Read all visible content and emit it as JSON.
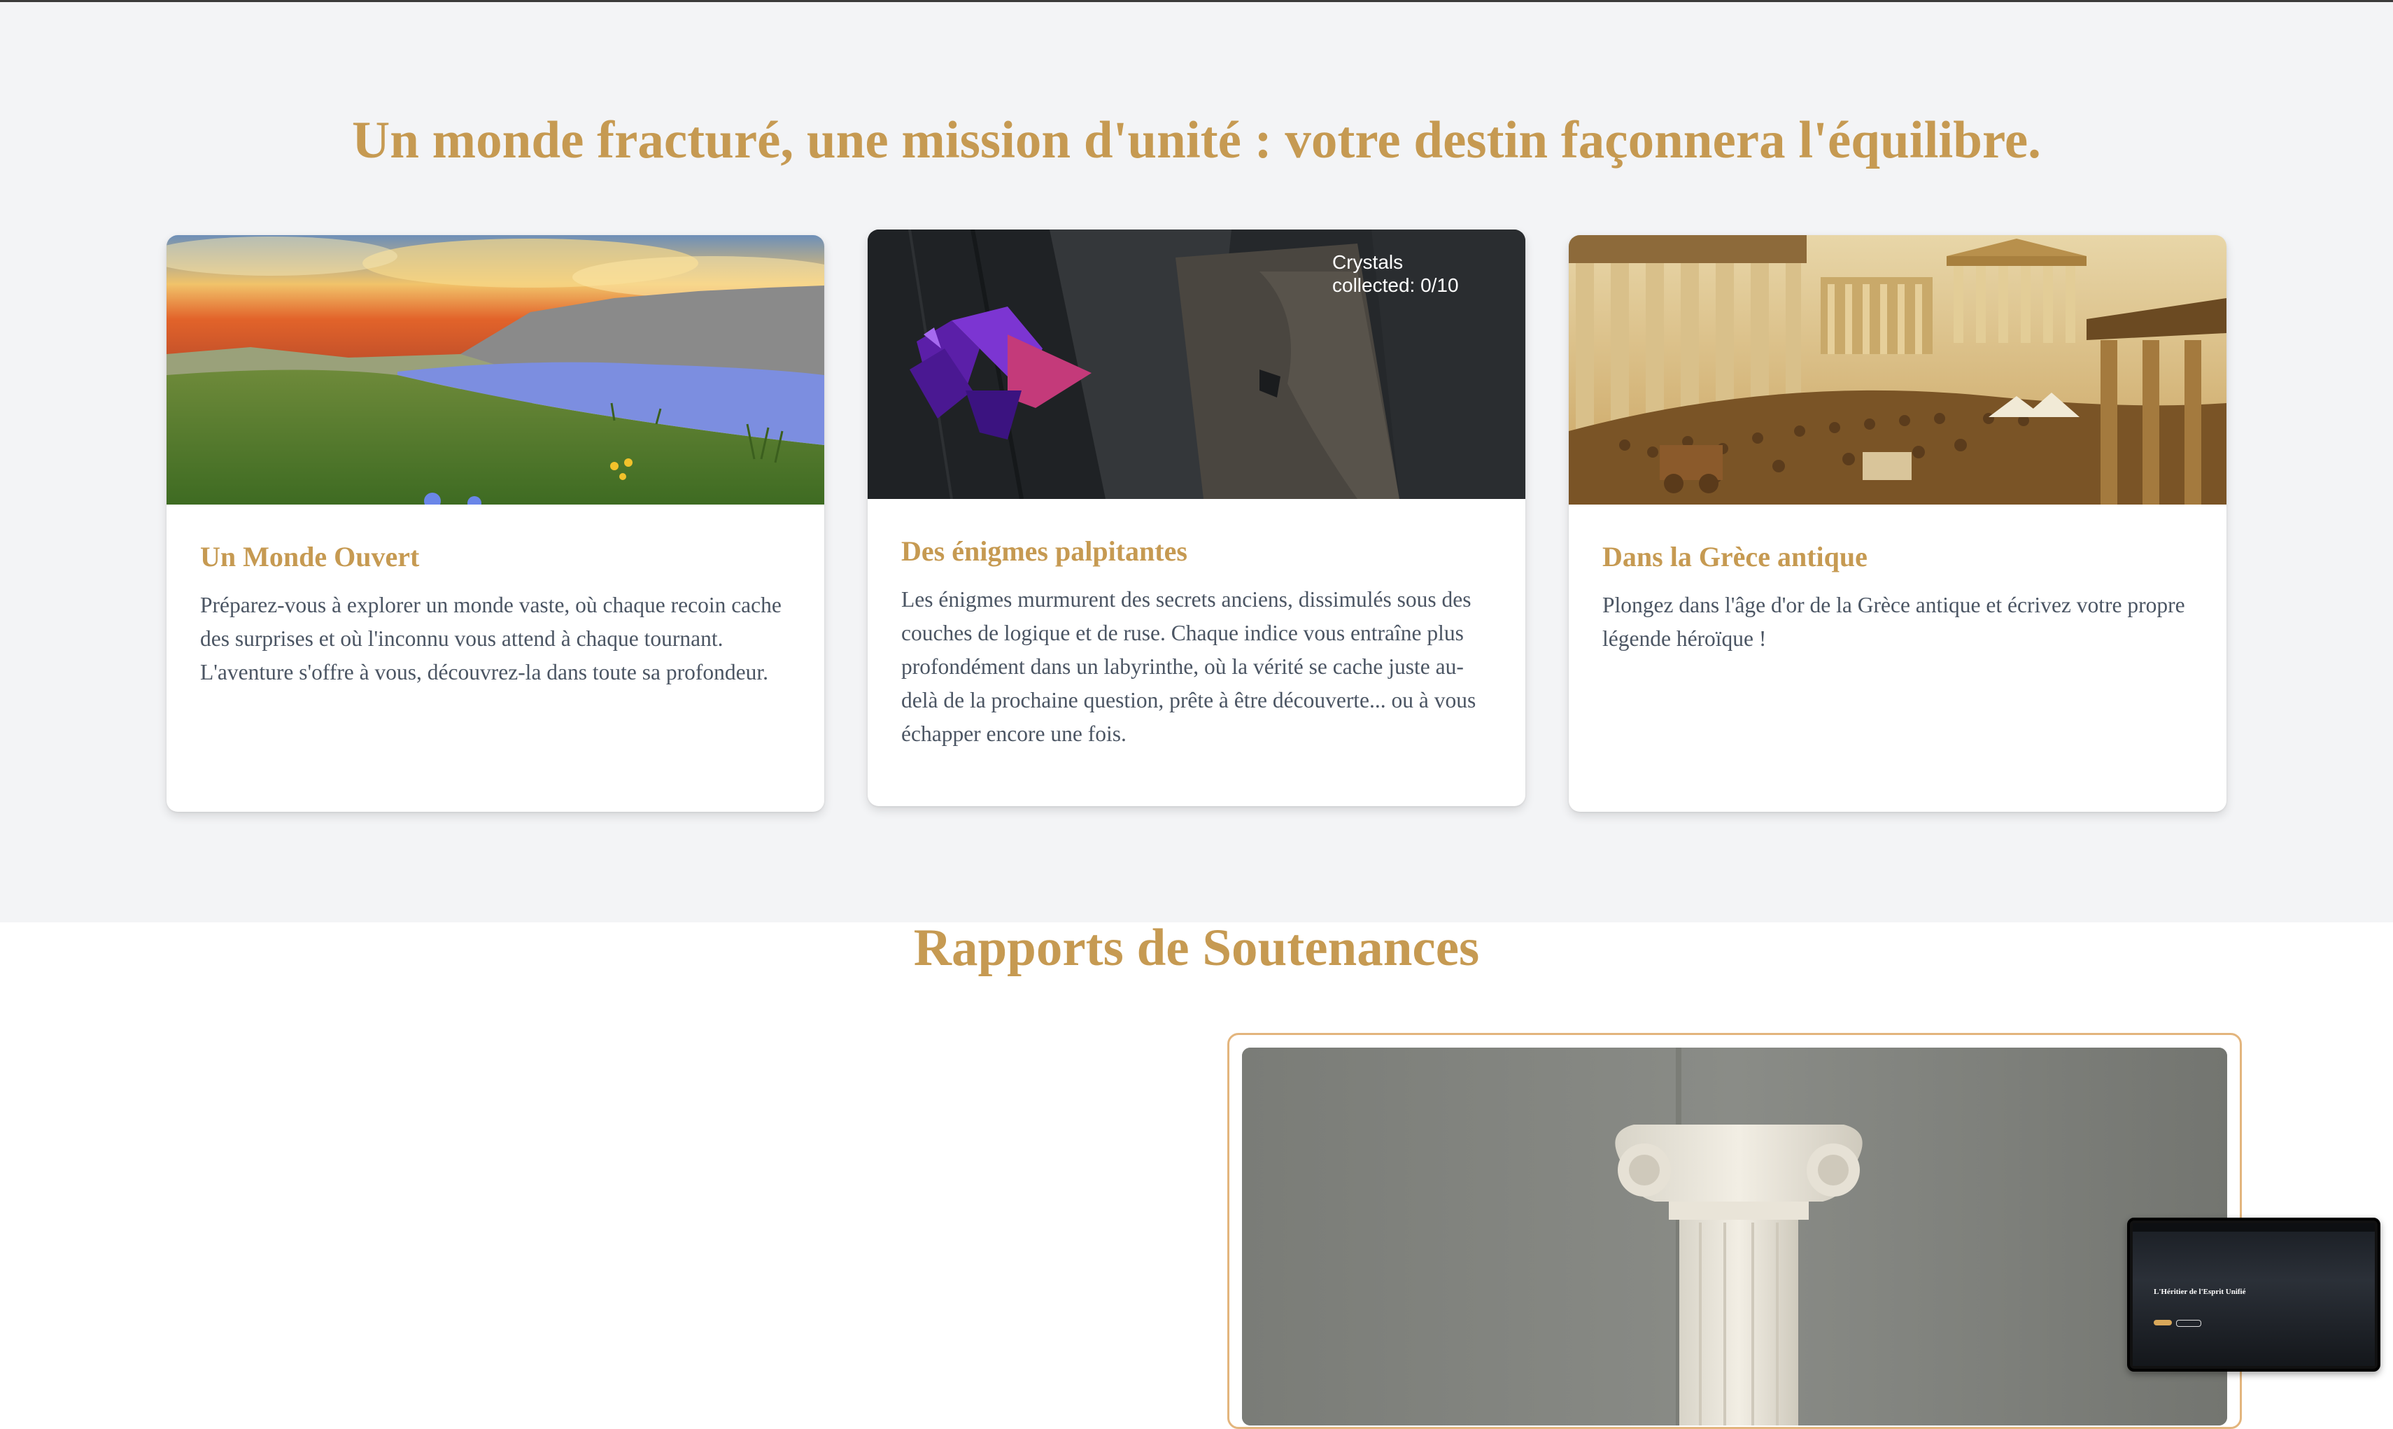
{
  "features": {
    "title": "Un monde fracturé, une mission d'unité : votre destin façonnera l'équilibre.",
    "cards": [
      {
        "title": "Un Monde Ouvert",
        "text": "Préparez-vous à explorer un monde vaste, où chaque recoin cache des surprises et où l'inconnu vous attend à chaque tournant. L'aventure s'offre à vous, découvrez-la dans toute sa profondeur."
      },
      {
        "title": "Des énigmes palpitantes",
        "text": "Les énigmes murmurent des secrets anciens, dissimulés sous des couches de logique et de ruse. Chaque indice vous entraîne plus profondément dans un labyrinthe, où la vérité se cache juste au-delà de la prochaine question, prête à être découverte... ou à vous échapper encore une fois.",
        "hud": "Crystals collected: 0/10"
      },
      {
        "title": "Dans la Grèce antique",
        "text": "Plongez dans l'âge d'or de la Grèce antique et écrivez votre propre légende héroïque !"
      }
    ]
  },
  "reports": {
    "title": "Rapports de Soutenances"
  },
  "pip": {
    "title": "L'Héritier de l'Esprit Unifié"
  },
  "colors": {
    "accent": "#c69a52",
    "section_bg": "#f3f4f6",
    "body_text": "#4b5563",
    "frame_border": "#e3b57d"
  }
}
